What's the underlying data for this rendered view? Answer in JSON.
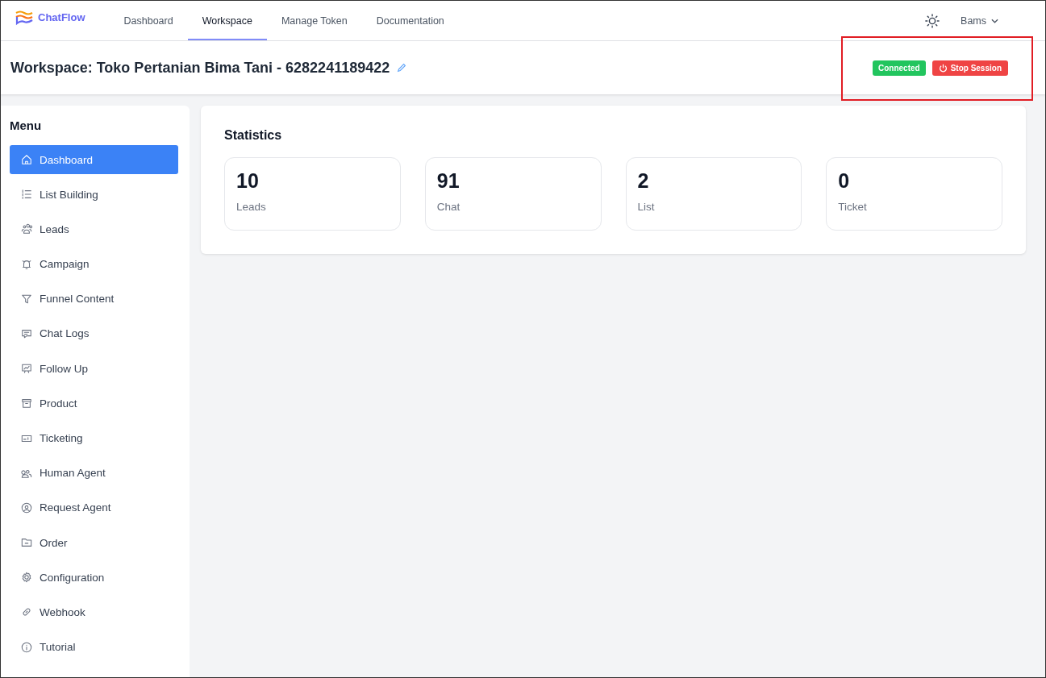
{
  "brand": "ChatFlow",
  "nav": [
    {
      "label": "Dashboard",
      "selected": false
    },
    {
      "label": "Workspace",
      "selected": true
    },
    {
      "label": "Manage Token",
      "selected": false
    },
    {
      "label": "Documentation",
      "selected": false
    }
  ],
  "user": "Bams",
  "workspace_title": "Workspace: Toko Pertanian Bima Tani - 6282241189422",
  "status_badge": "Connected",
  "stop_button": "Stop Session",
  "menu_title": "Menu",
  "menu": [
    {
      "label": "Dashboard",
      "selected": true
    },
    {
      "label": "List Building",
      "selected": false
    },
    {
      "label": "Leads",
      "selected": false
    },
    {
      "label": "Campaign",
      "selected": false
    },
    {
      "label": "Funnel Content",
      "selected": false
    },
    {
      "label": "Chat Logs",
      "selected": false
    },
    {
      "label": "Follow Up",
      "selected": false
    },
    {
      "label": "Product",
      "selected": false
    },
    {
      "label": "Ticketing",
      "selected": false
    },
    {
      "label": "Human Agent",
      "selected": false
    },
    {
      "label": "Request Agent",
      "selected": false
    },
    {
      "label": "Order",
      "selected": false
    },
    {
      "label": "Configuration",
      "selected": false
    },
    {
      "label": "Webhook",
      "selected": false
    },
    {
      "label": "Tutorial",
      "selected": false
    }
  ],
  "statistics": {
    "title": "Statistics",
    "cards": [
      {
        "value": "10",
        "label": "Leads"
      },
      {
        "value": "91",
        "label": "Chat"
      },
      {
        "value": "2",
        "label": "List"
      },
      {
        "value": "0",
        "label": "Ticket"
      }
    ]
  }
}
